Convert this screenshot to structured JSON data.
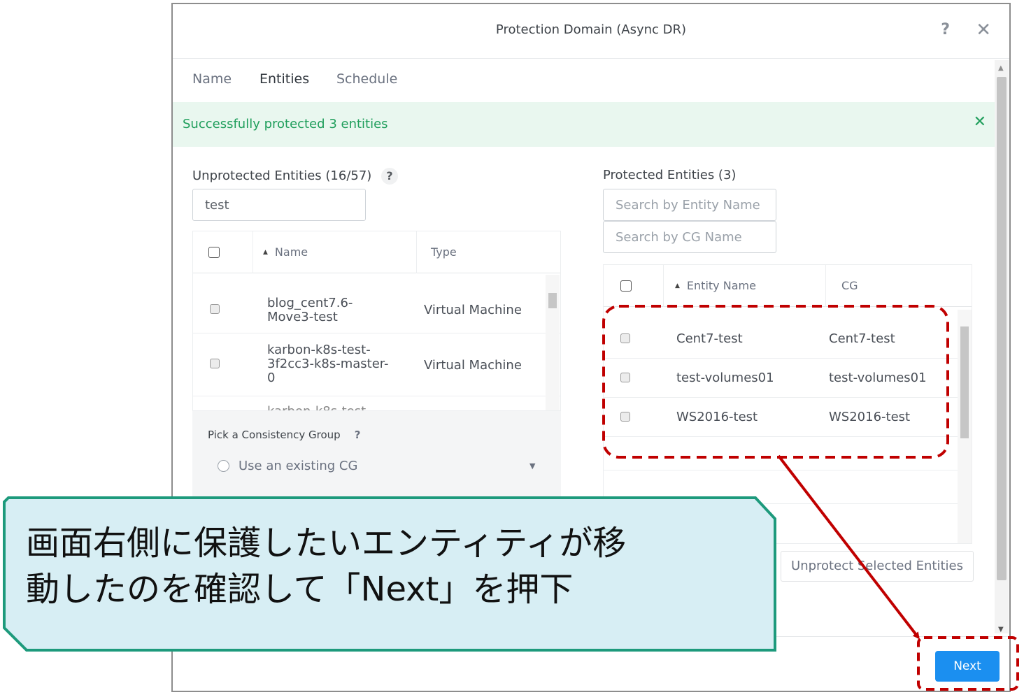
{
  "dialog": {
    "title": "Protection Domain (Async DR)",
    "help_icon": "?",
    "close_icon": "✕"
  },
  "tabs": [
    {
      "label": "Name"
    },
    {
      "label": "Entities"
    },
    {
      "label": "Schedule"
    }
  ],
  "banner": {
    "text": "Successfully protected 3 entities",
    "close_icon": "✕"
  },
  "unprotected": {
    "label": "Unprotected Entities (16/57)",
    "help": "?",
    "search_value": "test",
    "columns": {
      "name": "Name",
      "type": "Type"
    },
    "rows": [
      {
        "name": "blog_cent7.6-\nMove3-test",
        "type": "Virtual Machine"
      },
      {
        "name": "karbon-k8s-test-\n3f2cc3-k8s-master-\n0",
        "type": "Virtual Machine"
      }
    ]
  },
  "consistency_group": {
    "label": "Pick a Consistency Group",
    "help": "?",
    "option": "Use an existing CG"
  },
  "protected": {
    "label": "Protected Entities (3)",
    "search_entity_placeholder": "Search by Entity Name",
    "search_cg_placeholder": "Search by CG Name",
    "columns": {
      "entity": "Entity Name",
      "cg": "CG"
    },
    "rows": [
      {
        "entity": "Cent7-test",
        "cg": "Cent7-test"
      },
      {
        "entity": "test-volumes01",
        "cg": "test-volumes01"
      },
      {
        "entity": "WS2016-test",
        "cg": "WS2016-test"
      }
    ]
  },
  "buttons": {
    "unprotect": "Unprotect Selected Entities",
    "next": "Next"
  },
  "annotation": {
    "line1": "画面右側に保護したいエンティティが移",
    "line2": "動したのを確認して「Next」を押下",
    "callout_fill": "#d7eef4",
    "callout_border": "#1d9a7c",
    "highlight_color": "#c00000"
  }
}
